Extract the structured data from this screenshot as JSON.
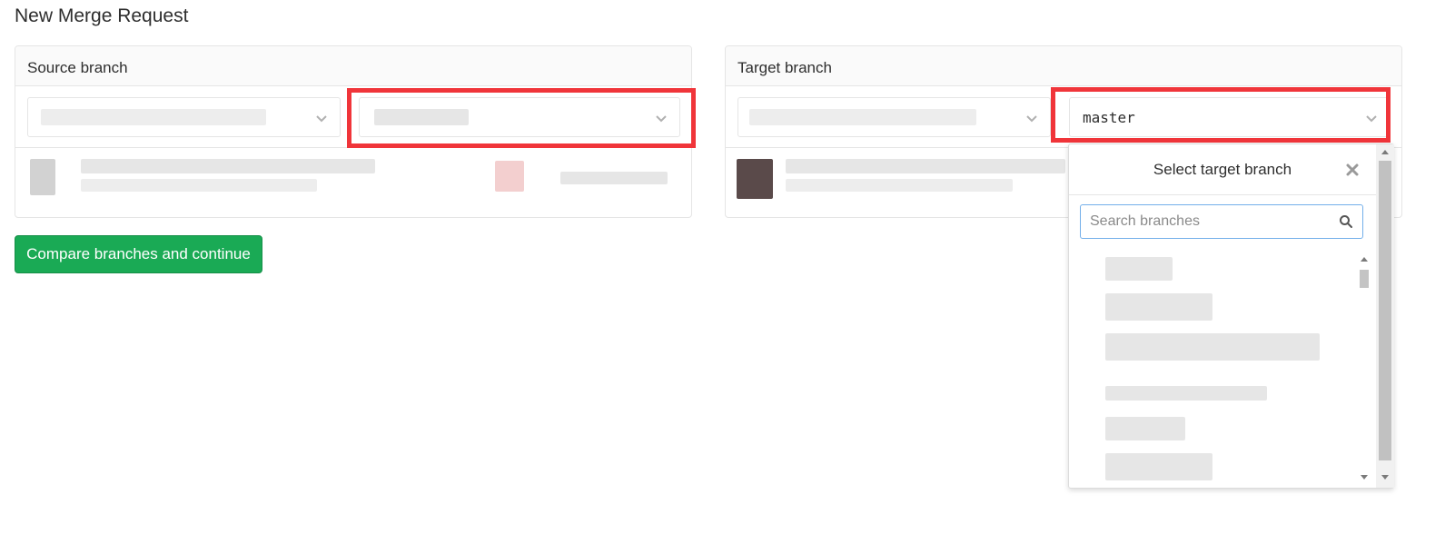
{
  "page": {
    "title": "New Merge Request"
  },
  "source": {
    "heading": "Source branch",
    "project_value": "",
    "branch_value": ""
  },
  "target": {
    "heading": "Target branch",
    "project_value": "",
    "branch_value": "master"
  },
  "actions": {
    "compare_label": "Compare branches and continue"
  },
  "dropdown": {
    "title": "Select target branch",
    "search_placeholder": "Search branches",
    "items": [
      "",
      "",
      "",
      "",
      "",
      ""
    ]
  },
  "colors": {
    "primary_green": "#1aaa55",
    "highlight_red": "#f0353a",
    "focus_blue": "#73afea"
  },
  "icons": {
    "select_chevron": "chevron-down-icon",
    "close": "close-icon",
    "search": "search-icon"
  }
}
